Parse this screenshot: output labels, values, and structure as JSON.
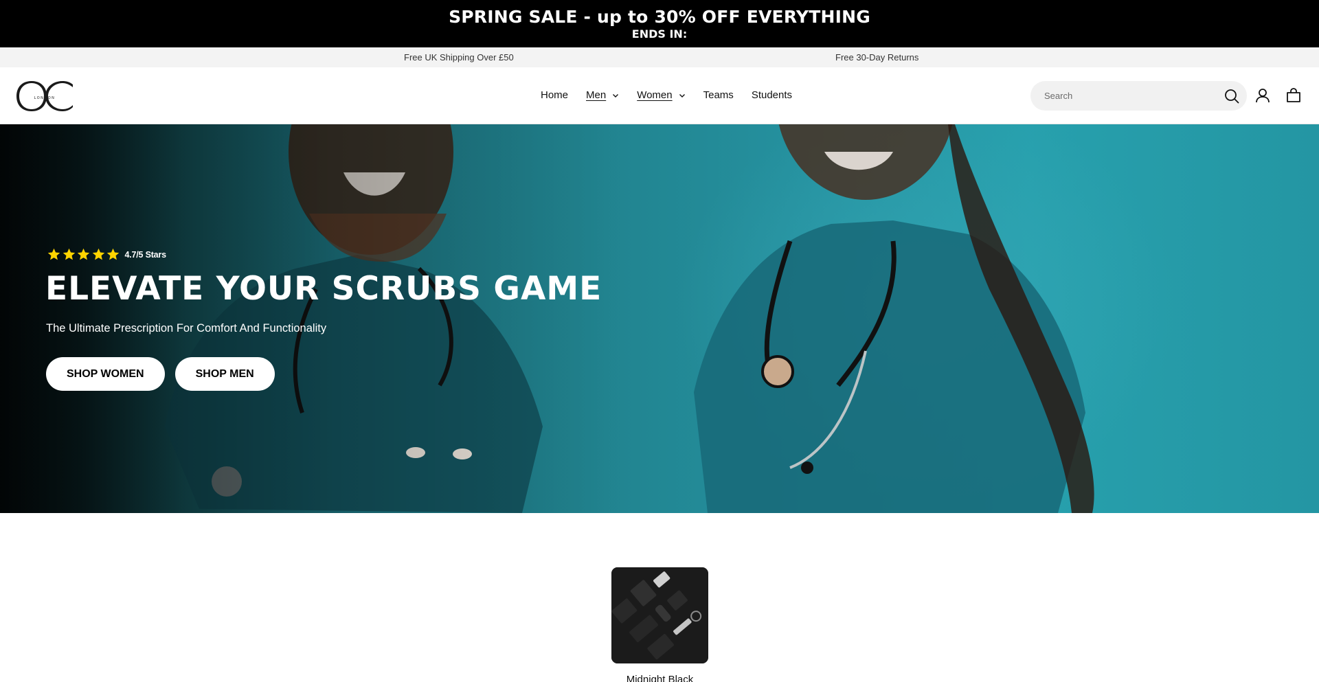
{
  "announcement": {
    "title": "SPRING SALE - up to 30% OFF EVERYTHING",
    "subtitle": "ENDS IN:"
  },
  "usp_bar": {
    "items": [
      "Free UK Shipping Over £50",
      "Free 30-Day Returns"
    ]
  },
  "header": {
    "logo": {
      "icon": "oc-london-logo",
      "text": "LONDON"
    },
    "nav": [
      {
        "label": "Home",
        "dropdown": false
      },
      {
        "label": "Men",
        "dropdown": true
      },
      {
        "label": "Women",
        "dropdown": true
      },
      {
        "label": "Teams",
        "dropdown": false
      },
      {
        "label": "Students",
        "dropdown": false
      }
    ],
    "search": {
      "placeholder": "Search",
      "icon": "search-icon"
    },
    "account_icon": "account-icon",
    "cart_icon": "cart-icon"
  },
  "hero": {
    "rating_text": "4.7/5 Stars",
    "rating_value": 5,
    "rating_max": 5,
    "title": "ELEVATE YOUR SCRUBS GAME",
    "subtitle": "The Ultimate Prescription For Comfort And Functionality",
    "buttons": [
      "SHOP WOMEN",
      "SHOP MEN"
    ]
  },
  "collection": {
    "label": "Midnight Black"
  },
  "colors": {
    "announcement_bg": "#000000",
    "usp_bg": "#f3f3f3",
    "hero_teal": "#2592a0",
    "star": "#ffd400",
    "button_bg": "#ffffff"
  }
}
